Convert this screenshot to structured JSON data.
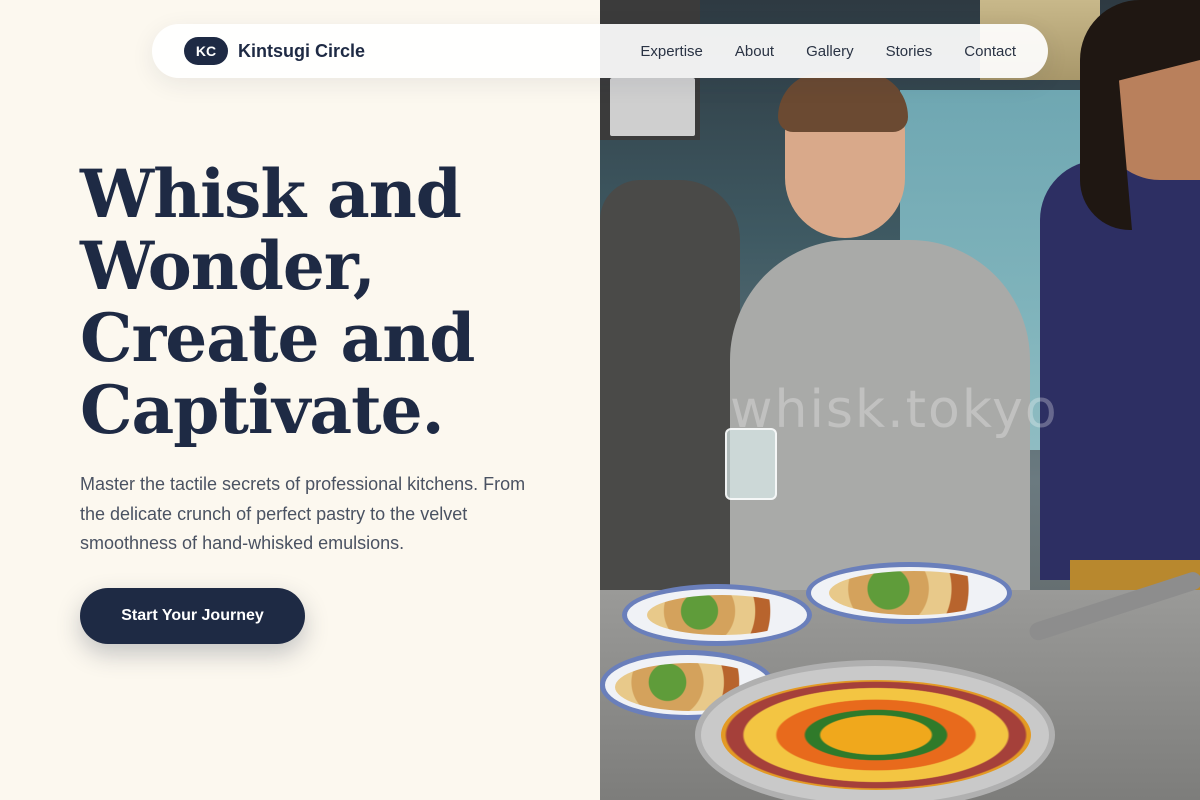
{
  "brand": {
    "badge": "KC",
    "name": "Kintsugi Circle"
  },
  "nav": {
    "links": [
      "Expertise",
      "About",
      "Gallery",
      "Stories",
      "Contact"
    ]
  },
  "hero": {
    "title_lines": [
      "Whisk and",
      "Wonder,",
      "Create and",
      "Captivate."
    ],
    "subtitle": "Master the tactile secrets of professional kitchens. From the delicate crunch of perfect pastry to the velvet smoothness of hand-whisked emulsions.",
    "cta_label": "Start Your Journey"
  },
  "image": {
    "watermark": "whisk.tokyo"
  },
  "colors": {
    "background": "#fcf8ef",
    "primary": "#1e2a44",
    "text_muted": "#4a5262"
  }
}
